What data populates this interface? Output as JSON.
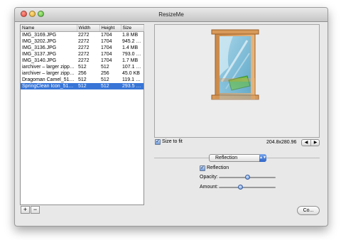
{
  "window": {
    "title": "ResizeMe"
  },
  "table": {
    "columns": [
      "Name",
      "Width",
      "Height",
      "Size"
    ],
    "rows": [
      {
        "name": "IMG_3169.JPG",
        "width": "2272",
        "height": "1704",
        "size": "1.8 MB"
      },
      {
        "name": "IMG_3202.JPG",
        "width": "2272",
        "height": "1704",
        "size": "945.2 KB"
      },
      {
        "name": "IMG_3136.JPG",
        "width": "2272",
        "height": "1704",
        "size": "1.4 MB"
      },
      {
        "name": "IMG_3137.JPG",
        "width": "2272",
        "height": "1704",
        "size": "793.0 KB"
      },
      {
        "name": "IMG_3140.JPG",
        "width": "2272",
        "height": "1704",
        "size": "1.7 MB"
      },
      {
        "name": "iarchiver – larger zipper...",
        "width": "512",
        "height": "512",
        "size": "107.1 KB"
      },
      {
        "name": "iarchiver – larger zipper...",
        "width": "256",
        "height": "256",
        "size": "45.0 KB"
      },
      {
        "name": "Dragoman Camel_512x...",
        "width": "512",
        "height": "512",
        "size": "119.1 KB"
      },
      {
        "name": "SpringClean Icon_512x5...",
        "width": "512",
        "height": "512",
        "size": "293.5 KB"
      }
    ],
    "selected_row": 8
  },
  "buttons": {
    "add": "+",
    "remove": "−",
    "convert": "Co..."
  },
  "size_to_fit": {
    "label": "Size to fit",
    "checked": true
  },
  "dimensions": "204.8x280.96",
  "stepper": {
    "left": "◀",
    "right": "▶"
  },
  "effect_popup": {
    "value": "Reflection"
  },
  "reflection": {
    "label": "Reflection",
    "checked": true
  },
  "sliders": {
    "opacity": {
      "label": "Opacity:",
      "value": 0.5
    },
    "amount": {
      "label": "Amount:",
      "value": 0.38
    }
  },
  "icons": {
    "preview": "window-cleaning-icon",
    "check": "checkmark-icon",
    "popup_arrow": "up-down-arrows-icon"
  }
}
